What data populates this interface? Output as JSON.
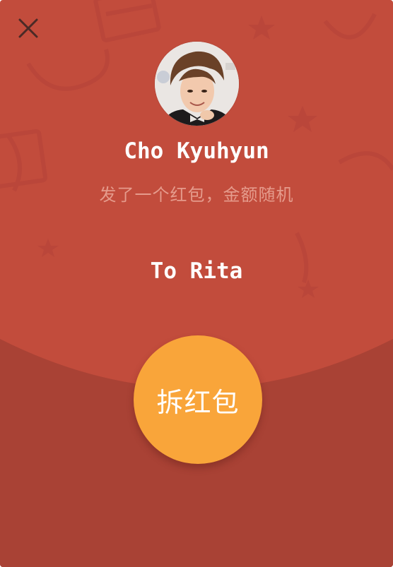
{
  "packet": {
    "sender_name": "Cho Kyuhyun",
    "subtitle": "发了一个红包，金额随机",
    "to_line": "To Rita",
    "open_button_label": "拆红包"
  },
  "icons": {
    "close": "close-icon",
    "avatar": "avatar"
  },
  "colors": {
    "background_top": "#c24c3c",
    "background_bottom": "#a94235",
    "button": "#f9a53a",
    "subtitle": "#e59b8c",
    "text": "#ffffff"
  }
}
